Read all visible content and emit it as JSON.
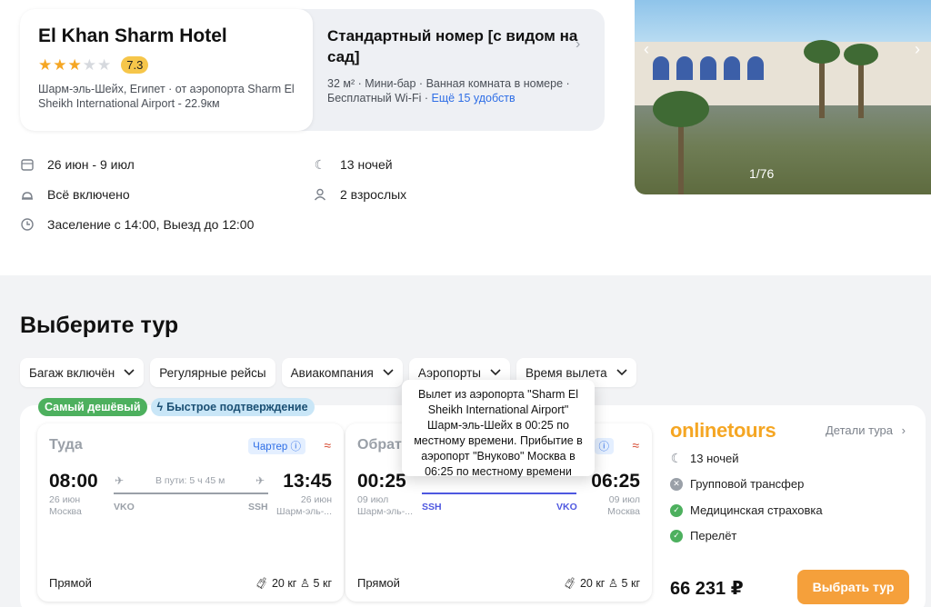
{
  "hotel": {
    "name": "El Khan Sharm Hotel",
    "stars": 3,
    "rating": "7.3",
    "location": "Шарм-эль-Шейх, Египет · от аэропорта Sharm El Sheikh International Airport - 22.9км"
  },
  "room": {
    "title": "Стандартный номер [с видом на сад]",
    "amenities": "32 м² · Мини-бар · Ванная комната в номере · Бесплатный Wi-Fi ·",
    "more_link": "Ещё 15 удобств"
  },
  "trip_info": {
    "dates": "26 июн - 9 июл",
    "nights": "13 ночей",
    "meal": "Всё включено",
    "guests": "2 взрослых",
    "checkin": "Заселение с 14:00, Выезд до 12:00"
  },
  "photo": {
    "counter": "1/76"
  },
  "section_title": "Выберите тур",
  "filters": [
    "Багаж включён",
    "Регулярные рейсы",
    "Авиакомпания",
    "Аэропорты",
    "Время вылета"
  ],
  "tags": [
    "Самый дешёвый",
    "Быстрое подтверждение"
  ],
  "outbound": {
    "label": "Туда",
    "charter": "Чартер",
    "dep_time": "08:00",
    "arr_time": "13:45",
    "duration": "В пути: 5 ч 45 м",
    "dep_date": "26 июн",
    "dep_city": "Москва",
    "arr_date": "26 июн",
    "arr_city": "Шарм-эль-...",
    "dep_airport": "VKO",
    "arr_airport": "SSH",
    "type": "Прямой",
    "baggage": "20 кг",
    "hand": "5 кг"
  },
  "inbound": {
    "label": "Обрат",
    "dep_time": "00:25",
    "arr_time": "06:25",
    "dep_date": "09 июл",
    "dep_city": "Шарм-эль-...",
    "arr_date": "09 июл",
    "arr_city": "Москва",
    "dep_airport": "SSH",
    "arr_airport": "VKO",
    "type": "Прямой",
    "baggage": "20 кг",
    "hand": "5 кг"
  },
  "tooltip": "Вылет из аэропорта \"Sharm El Sheikh International Airport\" Шарм-эль-Шейх в 00:25 по местному времени. Прибытие в аэропорт \"Внуково\" Москва в 06:25 по местному времени",
  "operator": {
    "brand": "onlinetours",
    "details": "Детали тура",
    "nights": "13 ночей",
    "transfer": "Групповой трансфер",
    "insurance": "Медицинская страховка",
    "flight": "Перелёт",
    "price": "66 231 ₽",
    "cta": "Выбрать тур"
  },
  "colors": {
    "accent": "#f5a03b",
    "brand": "#f5a623",
    "link": "#2e6ee6",
    "route": "#4f58e0",
    "green": "#4db05e"
  }
}
